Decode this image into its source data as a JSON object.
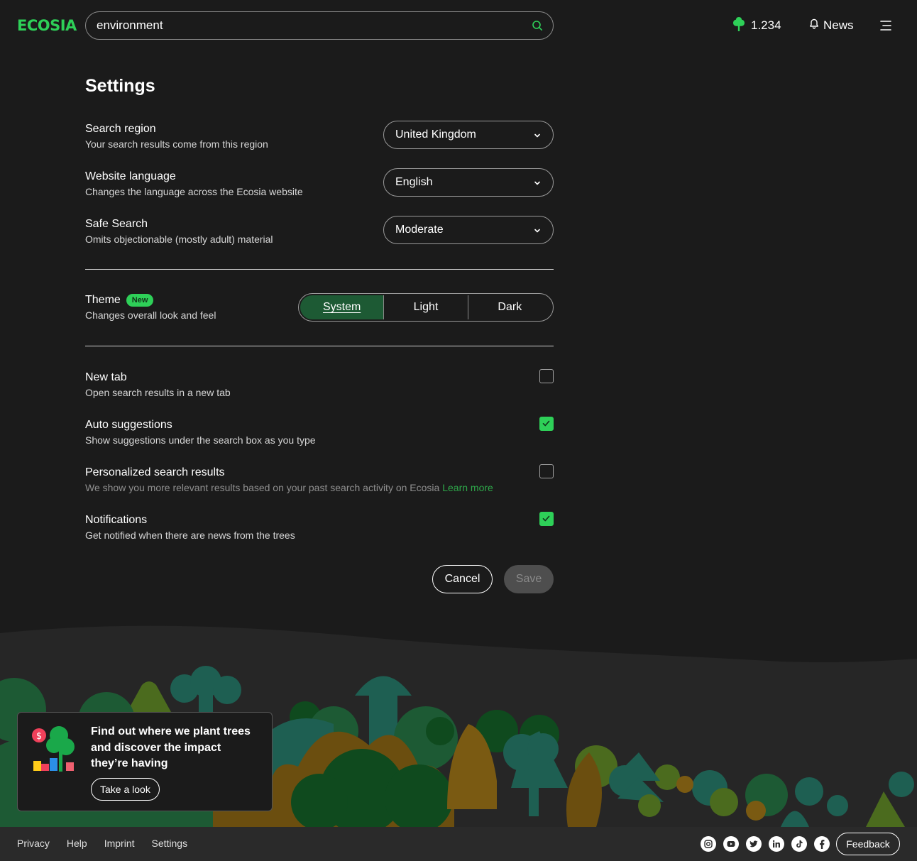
{
  "header": {
    "logo": "ECOSIA",
    "search_value": "environment",
    "tree_count": "1.234",
    "news_label": "News"
  },
  "settings": {
    "title": "Settings",
    "search_region": {
      "label": "Search region",
      "description": "Your search results come from this region",
      "value": "United Kingdom"
    },
    "website_language": {
      "label": "Website language",
      "description": "Changes the language across the Ecosia website",
      "value": "English"
    },
    "safe_search": {
      "label": "Safe Search",
      "description": "Omits objectionable (mostly adult) material",
      "value": "Moderate"
    },
    "theme": {
      "label": "Theme",
      "badge": "New",
      "description": "Changes overall look and feel",
      "options": [
        "System",
        "Light",
        "Dark"
      ],
      "selected": "System"
    },
    "new_tab": {
      "label": "New tab",
      "description": "Open search results in a new tab",
      "checked": false
    },
    "auto_suggestions": {
      "label": "Auto suggestions",
      "description": "Show suggestions under the search box as you type",
      "checked": true
    },
    "personalized": {
      "label": "Personalized search results",
      "description": "We show you more relevant results based on your past search activity on Ecosia",
      "link": "Learn more",
      "checked": false
    },
    "notifications": {
      "label": "Notifications",
      "description": "Get notified when there are news from the trees",
      "checked": true
    },
    "cancel_label": "Cancel",
    "save_label": "Save"
  },
  "promo": {
    "text": "Find out where we plant trees and discover the impact they’re having",
    "button_label": "Take a look"
  },
  "footer": {
    "links": [
      "Privacy",
      "Help",
      "Imprint",
      "Settings"
    ],
    "socials": [
      "instagram-icon",
      "youtube-icon",
      "twitter-icon",
      "linkedin-icon",
      "tiktok-icon",
      "facebook-icon"
    ],
    "feedback_label": "Feedback"
  },
  "colors": {
    "background": "#1b1b1b",
    "brand_green": "#2ed058",
    "active_segment": "#1d5a34",
    "footer": "#2a2a2a"
  }
}
